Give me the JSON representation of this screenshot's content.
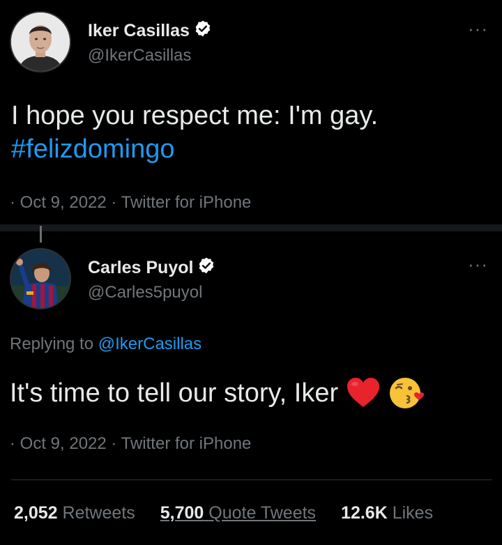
{
  "tweet1": {
    "name": "Iker Casillas",
    "handle": "@IkerCasillas",
    "text": "I hope you respect me: I'm gay.",
    "hashtag": "#felizdomingo",
    "meta": "· Oct 9, 2022 · Twitter for iPhone"
  },
  "tweet2": {
    "name": "Carles Puyol",
    "handle": "@Carles5puyol",
    "replying_prefix": "Replying to ",
    "replying_to": "@IkerCasillas",
    "text": "It's time to tell our story, Iker",
    "meta": "· Oct 9, 2022 · Twitter for iPhone"
  },
  "stats": {
    "retweets_count": "2,052",
    "retweets_label": "Retweets",
    "quotes_count": "5,700",
    "quotes_label": "Quote Tweets",
    "likes_count": "12.6K",
    "likes_label": "Likes"
  },
  "more_label": "···",
  "colors": {
    "background": "#000000",
    "text": "#e7e9ea",
    "secondary": "#71767b",
    "link": "#1d9bf0",
    "verified": "#ffffff"
  },
  "icons": {
    "verified": "verified-badge-icon",
    "more": "more-options-icon",
    "heart": "red-heart-emoji-icon",
    "kiss": "face-blowing-kiss-emoji-icon"
  }
}
